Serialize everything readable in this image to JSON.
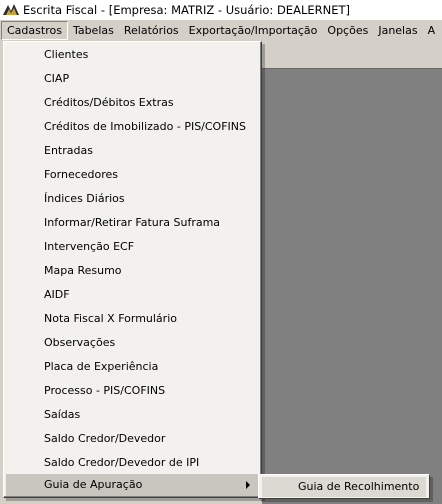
{
  "window": {
    "title": "Escrita Fiscal - [Empresa: MATRIZ - Usuário: DEALERNET]"
  },
  "menubar": {
    "items": [
      {
        "label": "Cadastros",
        "active": true
      },
      {
        "label": "Tabelas"
      },
      {
        "label": "Relatórios"
      },
      {
        "label": "Exportação/Importação"
      },
      {
        "label": "Opções"
      },
      {
        "label": "Janelas"
      },
      {
        "label": "A"
      }
    ]
  },
  "cadastros_menu": {
    "items": [
      {
        "label": "Clientes"
      },
      {
        "label": "CIAP"
      },
      {
        "label": "Créditos/Débitos Extras"
      },
      {
        "label": "Créditos de Imobilizado - PIS/COFINS"
      },
      {
        "label": "Entradas"
      },
      {
        "label": "Fornecedores"
      },
      {
        "label": "Índices Diários"
      },
      {
        "label": "Informar/Retirar Fatura Suframa"
      },
      {
        "label": "Intervenção ECF"
      },
      {
        "label": "Mapa Resumo"
      },
      {
        "label": "AIDF"
      },
      {
        "label": "Nota Fiscal X Formulário"
      },
      {
        "label": "Observações"
      },
      {
        "label": "Placa de Experiência"
      },
      {
        "label": "Processo - PIS/COFINS"
      },
      {
        "label": "Saídas"
      },
      {
        "label": "Saldo Credor/Devedor"
      },
      {
        "label": "Saldo Credor/Devedor de IPI"
      },
      {
        "label": "Guia de Apuração",
        "has_submenu": true,
        "selected": true
      }
    ]
  },
  "submenu": {
    "items": [
      {
        "label": "Guia de Recolhimento"
      }
    ]
  },
  "icons": {
    "app": "escrita-fiscal-app-icon",
    "submenu_arrow": "chevron-right-icon"
  },
  "colors": {
    "menu_background": "#f2f1ee",
    "workspace": "#808080",
    "chrome": "#d4d0c8"
  }
}
